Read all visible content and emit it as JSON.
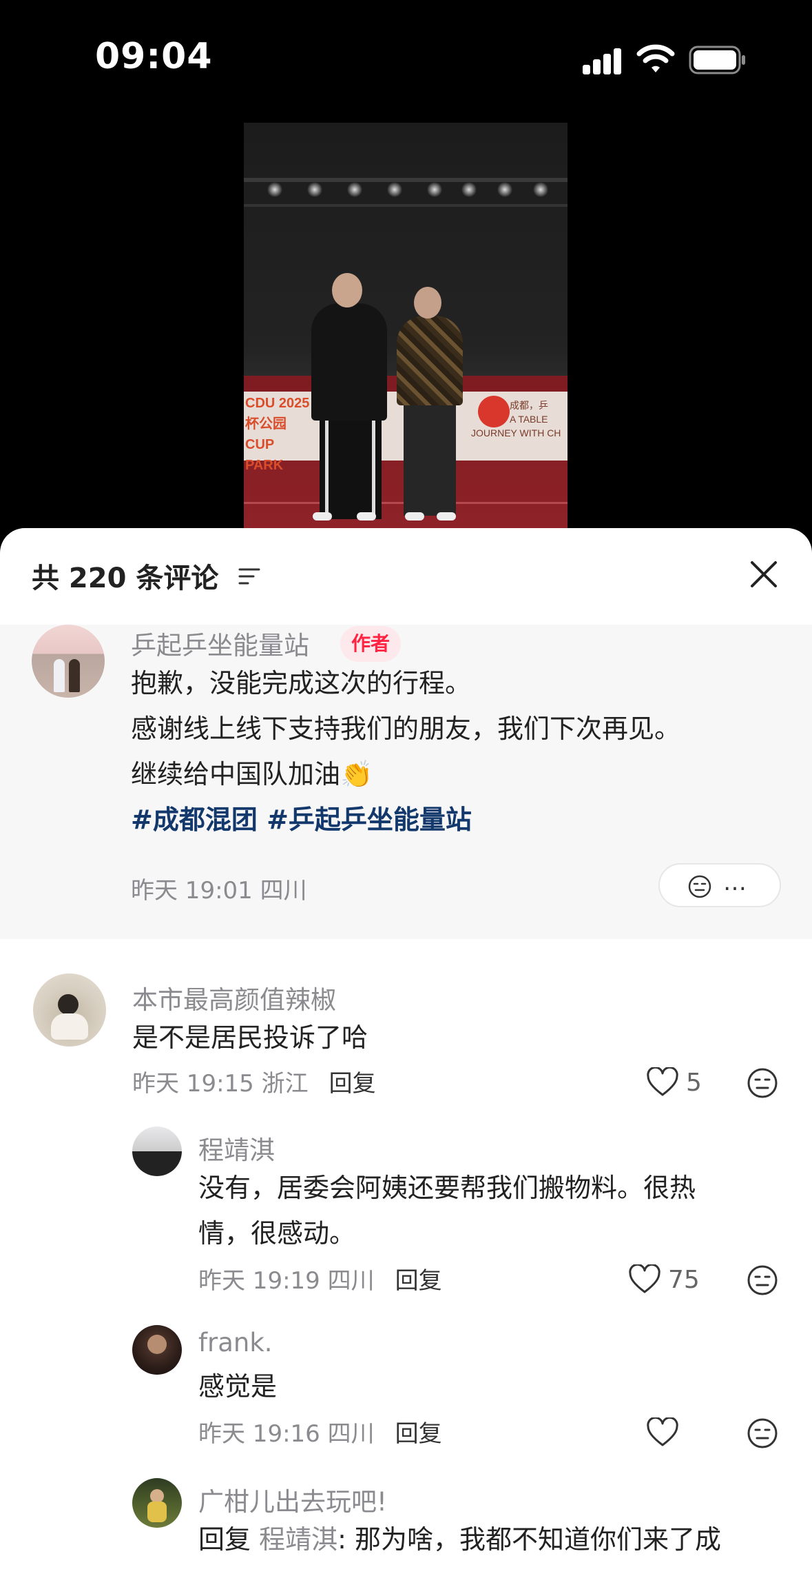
{
  "status_bar": {
    "time": "09:04"
  },
  "video": {
    "banner_left_lines": [
      "CDU 2025",
      "杯公园",
      "CUP PARK"
    ],
    "banner_right_lines": [
      "成都，乒",
      "A TABLE",
      "JOURNEY WITH CH"
    ]
  },
  "sheet": {
    "title": "共 220 条评论",
    "pinned": {
      "name": "乒起乒坐能量站",
      "badge": "作者",
      "lines": [
        "抱歉，没能完成这次的行程。",
        "感谢线上线下支持我们的朋友，我们下次再见。",
        "继续给中国队加油👏"
      ],
      "hashtags": "#成都混团 #乒起乒坐能量站",
      "meta": "昨天 19:01 四川",
      "more": "…"
    },
    "comments": [
      {
        "name": "本市最高颜值辣椒",
        "text": "是不是居民投诉了哈",
        "meta": "昨天 19:15 浙江",
        "reply": "回复",
        "likes": "5",
        "replies": [
          {
            "name": "程靖淇",
            "lines": [
              "没有，居委会阿姨还要帮我们搬物料。很热",
              "情，很感动。"
            ],
            "meta": "昨天 19:19 四川",
            "reply": "回复",
            "likes": "75"
          },
          {
            "name": "frank.",
            "lines": [
              "感觉是"
            ],
            "meta": "昨天 19:16 四川",
            "reply": "回复",
            "likes": ""
          },
          {
            "name": "广柑儿出去玩吧!",
            "reply_prefix": "回复",
            "mention": "程靖淇",
            "text": ": 那为啥，我都不知道你们来了成"
          }
        ]
      }
    ]
  }
}
